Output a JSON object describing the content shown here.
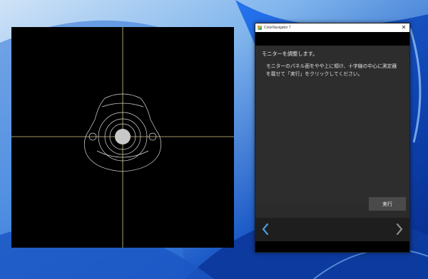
{
  "window": {
    "title": "ColorNavigator 7",
    "close_glyph": "✕"
  },
  "content": {
    "heading": "モニターを調整します。",
    "instruction": "モニターのパネル面をやや上に傾け、十字線の中心に測定器\nを載せて「実行」をクリックしてください。"
  },
  "buttons": {
    "execute_label": "実行"
  },
  "nav": {
    "prev_icon": "chevron-left-icon",
    "next_icon": "chevron-right-icon",
    "prev_color": "#4a9be0",
    "next_color": "#8a8a8a"
  },
  "colors": {
    "crosshair": "#d9c98a",
    "sensor_outline": "#d8d8d8",
    "sensor_center": "#c8c8c8",
    "wallpaper_base": "#0a3fa8",
    "wallpaper_light": "#6fb3ff"
  }
}
